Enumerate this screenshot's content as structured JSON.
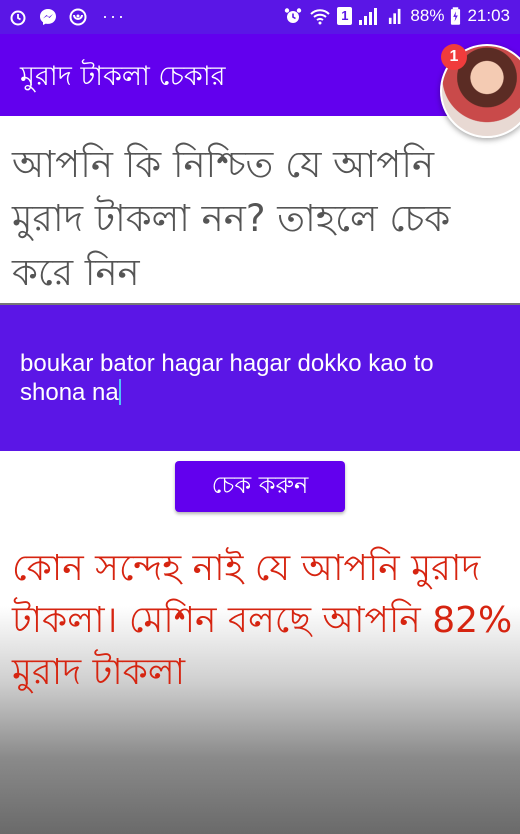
{
  "status_bar": {
    "battery": "88%",
    "time": "21:03",
    "sim_label": "1",
    "left_icons": [
      "alarm-icon",
      "messenger-icon",
      "vpn-icon"
    ],
    "right_icons": [
      "alarm-icon",
      "wifi-icon",
      "signal-icon",
      "battery-icon"
    ],
    "overflow": "···"
  },
  "app_bar": {
    "title": "মুরাদ টাকলা চেকার"
  },
  "chat_head": {
    "badge": "1"
  },
  "question": "আপনি কি নিশ্চিত যে আপনি মুরাদ টাকলা নন? তাহলে চেক করে নিন",
  "input": {
    "value": "boukar bator hagar hagar dokko kao to shona na"
  },
  "check_button": {
    "label": "চেক করুন"
  },
  "result": "কোন সন্দেহ নাই যে আপনি মুরাদ টাকলা। মেশিন বলছে আপনি 82% মুরাদ টাকলা",
  "colors": {
    "primary": "#6200ee",
    "input_bg": "#5b16e6",
    "result_text": "#d62410",
    "question_text": "#555555"
  }
}
